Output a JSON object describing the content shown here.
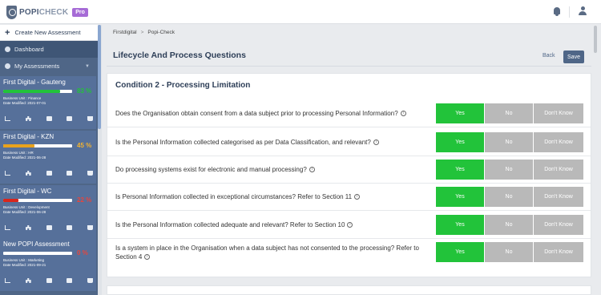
{
  "topbar": {
    "logo_main": "POPI",
    "logo_sub": "CHECK",
    "badge": "Pro"
  },
  "sidebar": {
    "create_label": "Create New Assessment",
    "dashboard_label": "Dashboard",
    "my_assessments_label": "My Assessments",
    "assessments": [
      {
        "title": "First Digital - Gauteng",
        "percent": "83 %",
        "progress": 0.83,
        "bar_color": "#22c33a",
        "pct_color": "#22c33a",
        "business_unit": "Business Unit : Finance",
        "date": "Date Modified: 2021-07-01"
      },
      {
        "title": "First Digital - KZN",
        "percent": "45 %",
        "progress": 0.45,
        "bar_color": "#e8a21c",
        "pct_color": "#f1b232",
        "business_unit": "Business Unit : HR",
        "date": "Date Modified: 2021-06-28"
      },
      {
        "title": "First Digital - WC",
        "percent": "22 %",
        "progress": 0.22,
        "bar_color": "#d9261c",
        "pct_color": "#e8453c",
        "business_unit": "Business Unit : Development",
        "date": "Date Modified: 2021-06-28"
      },
      {
        "title": "New POPI Assessment",
        "percent": "0 %",
        "progress": 0,
        "bar_color": "#d9261c",
        "pct_color": "#e8453c",
        "business_unit": "Business Unit : Marketing",
        "date": "Date Modified: 2021-09-21"
      }
    ]
  },
  "breadcrumb": [
    "Firstdigital",
    "Popi-Check"
  ],
  "breadcrumb_sep": ">",
  "header": {
    "title": "Lifecycle And Process Questions",
    "back": "Back",
    "save": "Save"
  },
  "section": {
    "title": "Condition 2 - Processing Limitation",
    "options": {
      "yes": "Yes",
      "no": "No",
      "dont_know": "Don't Know"
    },
    "info_glyph": "i",
    "questions": [
      {
        "text": "Does the Organisation obtain consent from a data subject prior to processing Personal Information?",
        "answer": "yes"
      },
      {
        "text": "Is the Personal Information collected categorised as per Data Classification, and relevant?",
        "answer": "yes"
      },
      {
        "text": "Do processing systems exist for electronic and manual processing?",
        "answer": "yes"
      },
      {
        "text": "Is Personal Information collected in exceptional circumstances? Refer to Section 11",
        "answer": "yes"
      },
      {
        "text": "Is the Personal Information collected adequate and relevant? Refer to Section 10",
        "answer": "yes"
      },
      {
        "text": "Is a system in place in the Organisation when a data subject has not consented to the processing? Refer to Section 4",
        "answer": "yes"
      }
    ]
  }
}
